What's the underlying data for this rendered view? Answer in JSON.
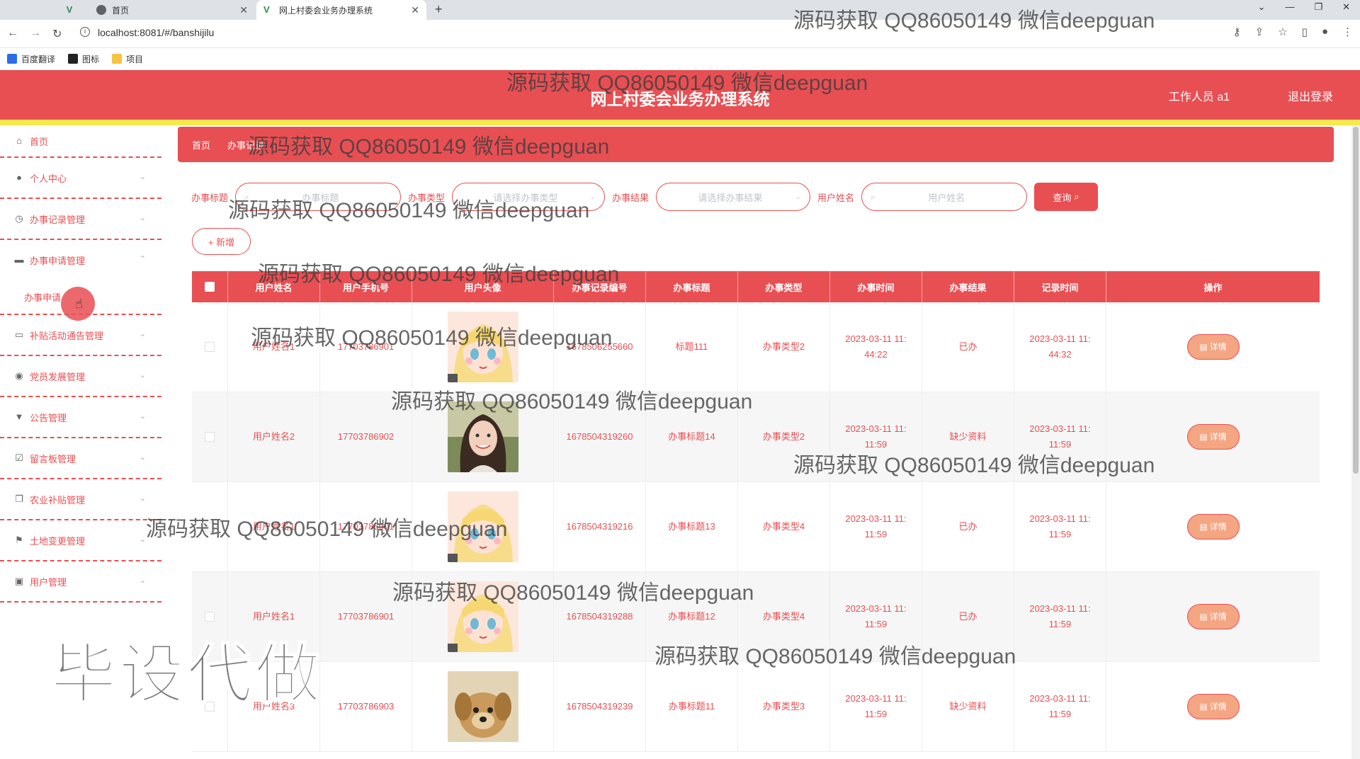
{
  "browser": {
    "tabs": [
      {
        "label": "首页"
      },
      {
        "label": "网上村委会业务办理系统"
      }
    ],
    "url": "localhost:8081/#/banshijilu",
    "bookmarks": [
      {
        "label": "百度翻译",
        "color": "#2b6de5"
      },
      {
        "label": "图标",
        "color": "#222222"
      },
      {
        "label": "项目",
        "color": "#f6c343"
      }
    ]
  },
  "header": {
    "title": "网上村委会业务办理系统",
    "user": "工作人员 a1",
    "logout": "退出登录",
    "color": "#e84f53"
  },
  "sidebar": {
    "items": [
      {
        "label": "首页",
        "icon": "home-icon"
      },
      {
        "label": "个人中心",
        "icon": "user-icon"
      },
      {
        "label": "办事记录管理",
        "icon": "clock-icon"
      },
      {
        "label": "办事申请管理",
        "icon": "folder-icon"
      },
      {
        "label": "补贴活动通告管理",
        "icon": "monitor-icon"
      },
      {
        "label": "党员发展管理",
        "icon": "location-icon"
      },
      {
        "label": "公告管理",
        "icon": "trophy-icon"
      },
      {
        "label": "留言板管理",
        "icon": "check-icon"
      },
      {
        "label": "农业补贴管理",
        "icon": "copy-icon"
      },
      {
        "label": "土地变更管理",
        "icon": "flag-icon"
      },
      {
        "label": "用户管理",
        "icon": "trash-icon"
      }
    ],
    "submenu_label": "办事申请"
  },
  "breadcrumb": {
    "home": "首页",
    "current": "办事记录"
  },
  "search": {
    "title_label": "办事标题",
    "title_placeholder": "办事标题",
    "type_label": "办事类型",
    "type_placeholder": "请选择办事类型",
    "result_label": "办事结果",
    "result_placeholder": "请选择办事结果",
    "user_label": "用户姓名",
    "user_placeholder": "用户姓名",
    "query_button": "查询"
  },
  "actions": {
    "add_button": "+ 新增"
  },
  "table": {
    "columns": [
      "用户姓名",
      "用户手机号",
      "用户头像",
      "办事记录编号",
      "办事标题",
      "办事类型",
      "办事时间",
      "办事结果",
      "记录时间",
      "操作"
    ],
    "detail_label": "详情",
    "rows": [
      {
        "name": "用户姓名1",
        "phone": "17703786901",
        "avatar": "anime-girl",
        "record_no": "1678506255660",
        "title": "标题111",
        "type": "办事类型2",
        "time": "2023-03-11 11:44:22",
        "result": "已办",
        "record_time": "2023-03-11 11:44:32"
      },
      {
        "name": "用户姓名2",
        "phone": "17703786902",
        "avatar": "woman-photo",
        "record_no": "1678504319260",
        "title": "办事标题14",
        "type": "办事类型2",
        "time": "2023-03-11 11:11:59",
        "result": "缺少资料",
        "record_time": "2023-03-11 11:11:59"
      },
      {
        "name": "用户姓名1",
        "phone": "17703786901",
        "avatar": "anime-girl",
        "record_no": "1678504319216",
        "title": "办事标题13",
        "type": "办事类型4",
        "time": "2023-03-11 11:11:59",
        "result": "已办",
        "record_time": "2023-03-11 11:11:59"
      },
      {
        "name": "用户姓名1",
        "phone": "17703786901",
        "avatar": "anime-girl",
        "record_no": "1678504319288",
        "title": "办事标题12",
        "type": "办事类型4",
        "time": "2023-03-11 11:11:59",
        "result": "已办",
        "record_time": "2023-03-11 11:11:59"
      },
      {
        "name": "用户姓名3",
        "phone": "17703786903",
        "avatar": "puppy-photo",
        "record_no": "1678504319239",
        "title": "办事标题11",
        "type": "办事类型3",
        "time": "2023-03-11 11:11:59",
        "result": "缺少资料",
        "record_time": "2023-03-11 11:11:59"
      }
    ]
  },
  "watermarks": {
    "text": "源码获取 QQ86050149 微信deepguan",
    "big": "毕设代做"
  }
}
